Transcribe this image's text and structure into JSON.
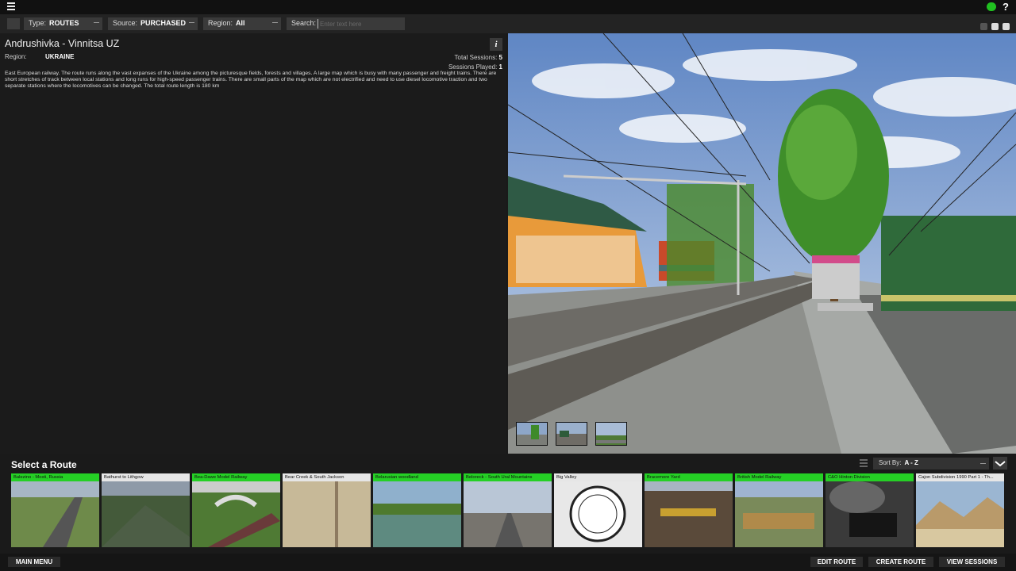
{
  "topbar": {
    "help": "?"
  },
  "filters": {
    "type": {
      "label": "Type:",
      "value": "ROUTES"
    },
    "source": {
      "label": "Source:",
      "value": "PURCHASED"
    },
    "region": {
      "label": "Region:",
      "value": "All"
    },
    "search": {
      "label": "Search:",
      "placeholder": "Enter text here",
      "value": ""
    }
  },
  "route": {
    "title": "Andrushivka - Vinnitsa UZ",
    "region_label": "Region:",
    "region_value": "UKRAINE",
    "total_sessions_label": "Total Sessions:",
    "total_sessions": "5",
    "sessions_played_label": "Sessions Played:",
    "sessions_played": "1",
    "description": "East European railway. The route runs along the vast expanses of the Ukraine among the picturesque fields, forests and villages. A large map which is busy with many passenger and freight trains. There are short stretches of track between local stations and long runs for high-speed passenger trains. There are small parts of the map which are not electrified and need to use diesel locomotive traction and two separate stations where the locomotives can be changed. The total route length is 180 km"
  },
  "info_button": "i",
  "list": {
    "title": "Select a Route",
    "sort_label": "Sort By:",
    "sort_value": "A - Z",
    "items": [
      {
        "name": "Balezino - Mosti, Russia",
        "color": "#25d025"
      },
      {
        "name": "Bathurst to Lithgow",
        "color": "#e6e6e6"
      },
      {
        "name": "Bea-Dawe Model Railway",
        "color": "#25d025"
      },
      {
        "name": "Bear Creek & South Jackson",
        "color": "#e6e6e6"
      },
      {
        "name": "Belarusian woodland",
        "color": "#25d025"
      },
      {
        "name": "Beloreck - South Ural Mountains",
        "color": "#25d025"
      },
      {
        "name": "Big Valley",
        "color": "#e6e6e6"
      },
      {
        "name": "Bracemore Yard",
        "color": "#25d025"
      },
      {
        "name": "British Model Railway",
        "color": "#25d025"
      },
      {
        "name": "C&O Hinton Division",
        "color": "#25d025"
      },
      {
        "name": "Cajon Subdivision 1990 Part 1 - Th...",
        "color": "#e6e6e6"
      }
    ]
  },
  "bottom": {
    "main_menu": "MAIN MENU",
    "edit_route": "EDIT ROUTE",
    "create_route": "CREATE ROUTE",
    "view_sessions": "VIEW SESSIONS"
  }
}
